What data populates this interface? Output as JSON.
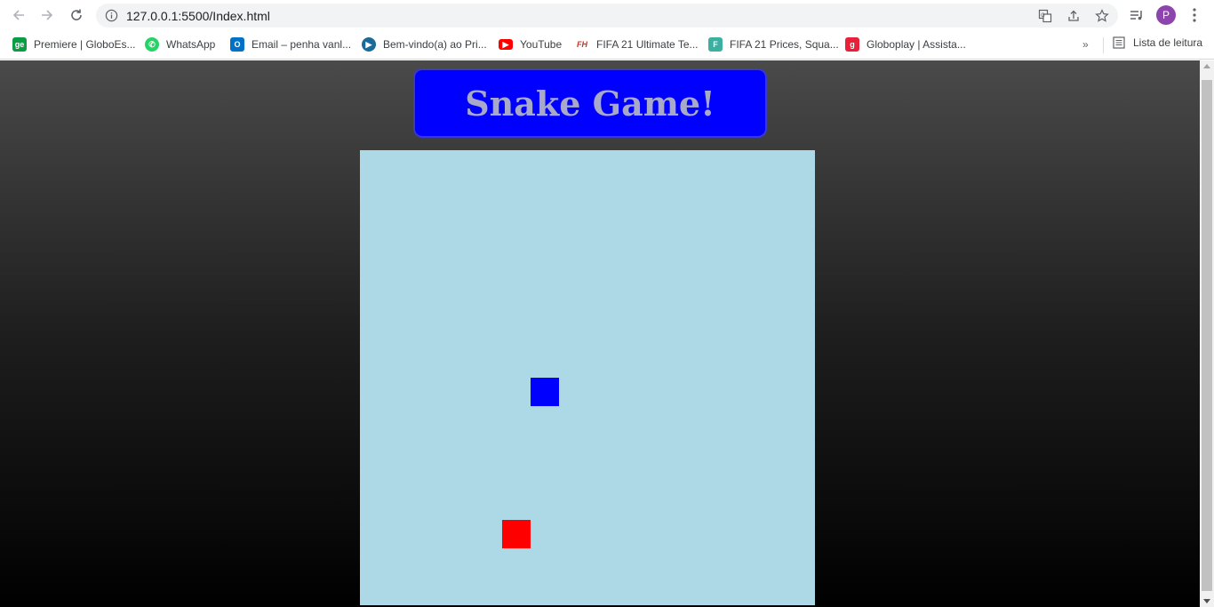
{
  "browser": {
    "url": "127.0.0.1:5500/Index.html",
    "profile_initial": "P"
  },
  "bookmarks": [
    {
      "label": "Premiere | GloboEs...",
      "icon": "ge-icon",
      "color": "#0a9d46",
      "glyph": "ge"
    },
    {
      "label": "WhatsApp",
      "icon": "whatsapp-icon",
      "color": "#25d366",
      "glyph": ""
    },
    {
      "label": "Email – penha vanl...",
      "icon": "outlook-icon",
      "color": "#0072c6",
      "glyph": "O"
    },
    {
      "label": "Bem-vindo(a) ao Pri...",
      "icon": "prime-video-icon",
      "color": "#1a6a9a",
      "glyph": "▶"
    },
    {
      "label": "YouTube",
      "icon": "youtube-icon",
      "color": "#ff0000",
      "glyph": "▶"
    },
    {
      "label": "FIFA 21 Ultimate Te...",
      "icon": "futhead-icon",
      "color": "#c0392b",
      "glyph": "FH"
    },
    {
      "label": "FIFA 21 Prices, Squa...",
      "icon": "futbin-icon",
      "color": "#3bb0a0",
      "glyph": "F"
    },
    {
      "label": "Globoplay | Assista...",
      "icon": "globoplay-icon",
      "color": "#e8213a",
      "glyph": "g"
    }
  ],
  "reading_list": "Lista de leitura",
  "page": {
    "title": "Snake Game!"
  },
  "game": {
    "grid_columns": 16,
    "grid_rows": 16,
    "snake": [
      {
        "col": 6,
        "row": 8
      }
    ],
    "food": {
      "col": 5,
      "row": 13
    },
    "snake_color": "#0000ff",
    "food_color": "#ff0000",
    "board_color": "#add8e6"
  }
}
